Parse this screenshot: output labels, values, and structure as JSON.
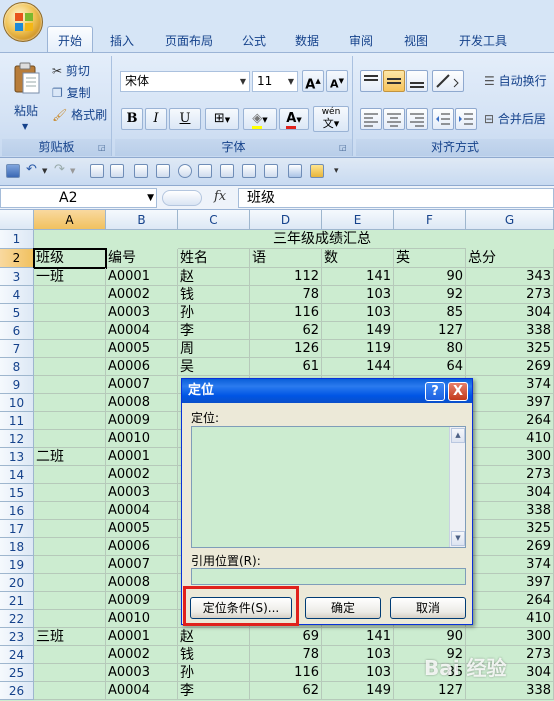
{
  "tabs": [
    "开始",
    "插入",
    "页面布局",
    "公式",
    "数据",
    "审阅",
    "视图",
    "开发工具"
  ],
  "clipboard": {
    "paste": "粘贴",
    "cut": "剪切",
    "copy": "复制",
    "format_painter": "格式刷",
    "label": "剪贴板"
  },
  "font": {
    "name": "宋体",
    "size": "11",
    "label": "字体",
    "bold": "B",
    "italic": "I",
    "underline": "U",
    "wen": "wén",
    "font_color": "A"
  },
  "alignment": {
    "wrap": "自动换行",
    "merge": "合并后居",
    "label": "对齐方式"
  },
  "namebox": "A2",
  "fx": "fx",
  "formula": "班级",
  "columns": [
    "A",
    "B",
    "C",
    "D",
    "E",
    "F",
    "G"
  ],
  "sheet_title": "三年级成绩汇总",
  "header_row": [
    "班级",
    "编号",
    "姓名",
    "语",
    "数",
    "英",
    "总分"
  ],
  "rows": [
    {
      "num": "3",
      "a": "一班",
      "b": "A0001",
      "c": "赵",
      "d": "112",
      "e": "141",
      "f": "90",
      "g": "343"
    },
    {
      "num": "4",
      "a": "",
      "b": "A0002",
      "c": "钱",
      "d": "78",
      "e": "103",
      "f": "92",
      "g": "273"
    },
    {
      "num": "5",
      "a": "",
      "b": "A0003",
      "c": "孙",
      "d": "116",
      "e": "103",
      "f": "85",
      "g": "304"
    },
    {
      "num": "6",
      "a": "",
      "b": "A0004",
      "c": "李",
      "d": "62",
      "e": "149",
      "f": "127",
      "g": "338"
    },
    {
      "num": "7",
      "a": "",
      "b": "A0005",
      "c": "周",
      "d": "126",
      "e": "119",
      "f": "80",
      "g": "325"
    },
    {
      "num": "8",
      "a": "",
      "b": "A0006",
      "c": "吴",
      "d": "61",
      "e": "144",
      "f": "64",
      "g": "269"
    },
    {
      "num": "9",
      "a": "",
      "b": "A0007",
      "c": "",
      "d": "",
      "e": "",
      "f": "",
      "g": "374"
    },
    {
      "num": "10",
      "a": "",
      "b": "A0008",
      "c": "",
      "d": "",
      "e": "",
      "f": "",
      "g": "397"
    },
    {
      "num": "11",
      "a": "",
      "b": "A0009",
      "c": "",
      "d": "",
      "e": "",
      "f": "",
      "g": "264"
    },
    {
      "num": "12",
      "a": "",
      "b": "A0010",
      "c": "",
      "d": "",
      "e": "",
      "f": "",
      "g": "410"
    },
    {
      "num": "13",
      "a": "二班",
      "b": "A0001",
      "c": "",
      "d": "",
      "e": "",
      "f": "",
      "g": "300"
    },
    {
      "num": "14",
      "a": "",
      "b": "A0002",
      "c": "",
      "d": "",
      "e": "",
      "f": "",
      "g": "273"
    },
    {
      "num": "15",
      "a": "",
      "b": "A0003",
      "c": "",
      "d": "",
      "e": "",
      "f": "",
      "g": "304"
    },
    {
      "num": "16",
      "a": "",
      "b": "A0004",
      "c": "",
      "d": "",
      "e": "",
      "f": "",
      "g": "338"
    },
    {
      "num": "17",
      "a": "",
      "b": "A0005",
      "c": "",
      "d": "",
      "e": "",
      "f": "",
      "g": "325"
    },
    {
      "num": "18",
      "a": "",
      "b": "A0006",
      "c": "",
      "d": "",
      "e": "",
      "f": "",
      "g": "269"
    },
    {
      "num": "19",
      "a": "",
      "b": "A0007",
      "c": "",
      "d": "",
      "e": "",
      "f": "",
      "g": "374"
    },
    {
      "num": "20",
      "a": "",
      "b": "A0008",
      "c": "",
      "d": "",
      "e": "",
      "f": "",
      "g": "397"
    },
    {
      "num": "21",
      "a": "",
      "b": "A0009",
      "c": "",
      "d": "",
      "e": "",
      "f": "",
      "g": "264"
    },
    {
      "num": "22",
      "a": "",
      "b": "A0010",
      "c": "",
      "d": "",
      "e": "",
      "f": "",
      "g": "410"
    },
    {
      "num": "23",
      "a": "三班",
      "b": "A0001",
      "c": "赵",
      "d": "69",
      "e": "141",
      "f": "90",
      "g": "300"
    },
    {
      "num": "24",
      "a": "",
      "b": "A0002",
      "c": "钱",
      "d": "78",
      "e": "103",
      "f": "92",
      "g": "273"
    },
    {
      "num": "25",
      "a": "",
      "b": "A0003",
      "c": "孙",
      "d": "116",
      "e": "103",
      "f": "85",
      "g": "304"
    },
    {
      "num": "26",
      "a": "",
      "b": "A0004",
      "c": "李",
      "d": "62",
      "e": "149",
      "f": "127",
      "g": "338"
    }
  ],
  "dialog": {
    "title": "定位",
    "help": "?",
    "close": "X",
    "goto_label": "定位:",
    "ref_label": "引用位置(R):",
    "special_button": "定位条件(S)...",
    "ok_button": "确定",
    "cancel_button": "取消"
  },
  "watermark": "Bai 经验",
  "colors": {
    "accent": "#15428b",
    "cell_bg": "#ccecd0",
    "highlight": "#e0211c",
    "title_bar": "#0a5fd9"
  }
}
